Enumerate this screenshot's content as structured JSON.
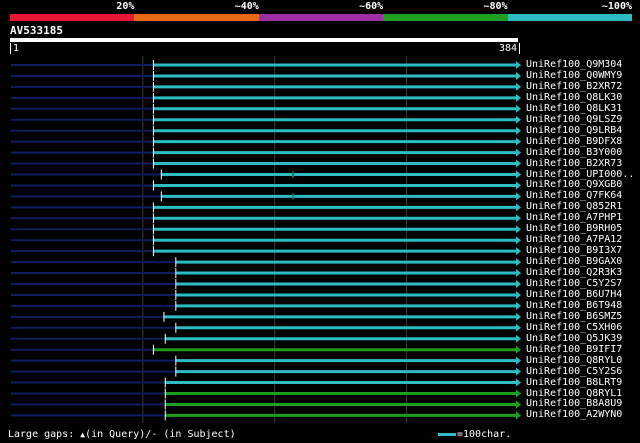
{
  "legend": {
    "segments": [
      {
        "label": "20%",
        "color": "#e8173a"
      },
      {
        "label": "~40%",
        "color": "#e86a17"
      },
      {
        "label": "~60%",
        "color": "#9b2fa3"
      },
      {
        "label": "~80%",
        "color": "#1e9e1e"
      },
      {
        "label": "~100%",
        "color": "#2bbcc6"
      }
    ]
  },
  "query": {
    "id": "AV533185",
    "start": "1",
    "end": "384"
  },
  "colors": {
    "background_line": "#0e1e63",
    "grid": "#3a3a3a",
    "gap_marker": "#1a7a5a"
  },
  "hits": [
    {
      "label": "UniRef100_Q9M304",
      "start": 109,
      "end": 384,
      "color": "#2bbcc6",
      "gap": null
    },
    {
      "label": "UniRef100_Q0WMY9",
      "start": 109,
      "end": 384,
      "color": "#2bbcc6",
      "gap": null
    },
    {
      "label": "UniRef100_B2XR72",
      "start": 109,
      "end": 384,
      "color": "#2bbcc6",
      "gap": null
    },
    {
      "label": "UniRef100_Q8LK30",
      "start": 109,
      "end": 384,
      "color": "#2bbcc6",
      "gap": null
    },
    {
      "label": "UniRef100_Q8LK31",
      "start": 109,
      "end": 384,
      "color": "#2bbcc6",
      "gap": null
    },
    {
      "label": "UniRef100_Q9LSZ9",
      "start": 109,
      "end": 384,
      "color": "#2bbcc6",
      "gap": null
    },
    {
      "label": "UniRef100_Q9LRB4",
      "start": 109,
      "end": 384,
      "color": "#2bbcc6",
      "gap": null
    },
    {
      "label": "UniRef100_B9DFX8",
      "start": 109,
      "end": 384,
      "color": "#2bbcc6",
      "gap": null
    },
    {
      "label": "UniRef100_B3Y000",
      "start": 109,
      "end": 384,
      "color": "#2bbcc6",
      "gap": null
    },
    {
      "label": "UniRef100_B2XR73",
      "start": 109,
      "end": 384,
      "color": "#2bbcc6",
      "gap": null
    },
    {
      "label": "UniRef100_UPI000..",
      "start": 115,
      "end": 384,
      "color": "#2bbcc6",
      "gap": 215
    },
    {
      "label": "UniRef100_Q9XGB0",
      "start": 109,
      "end": 384,
      "color": "#2bbcc6",
      "gap": null
    },
    {
      "label": "UniRef100_Q7FK64",
      "start": 115,
      "end": 384,
      "color": "#2bbcc6",
      "gap": 215
    },
    {
      "label": "UniRef100_Q852R1",
      "start": 109,
      "end": 384,
      "color": "#2bbcc6",
      "gap": null
    },
    {
      "label": "UniRef100_A7PHP1",
      "start": 109,
      "end": 384,
      "color": "#2bbcc6",
      "gap": null
    },
    {
      "label": "UniRef100_B9RH05",
      "start": 109,
      "end": 384,
      "color": "#2bbcc6",
      "gap": null
    },
    {
      "label": "UniRef100_A7PA12",
      "start": 109,
      "end": 384,
      "color": "#2bbcc6",
      "gap": null
    },
    {
      "label": "UniRef100_B9I3X7",
      "start": 109,
      "end": 384,
      "color": "#2bbcc6",
      "gap": null
    },
    {
      "label": "UniRef100_B9GAX0",
      "start": 126,
      "end": 384,
      "color": "#2bbcc6",
      "gap": null
    },
    {
      "label": "UniRef100_Q2R3K3",
      "start": 126,
      "end": 384,
      "color": "#2bbcc6",
      "gap": null
    },
    {
      "label": "UniRef100_C5Y2S7",
      "start": 126,
      "end": 384,
      "color": "#2bbcc6",
      "gap": null
    },
    {
      "label": "UniRef100_B6U7H4",
      "start": 126,
      "end": 384,
      "color": "#2bbcc6",
      "gap": null
    },
    {
      "label": "UniRef100_B6T948",
      "start": 126,
      "end": 384,
      "color": "#2bbcc6",
      "gap": null
    },
    {
      "label": "UniRef100_B6SMZ5",
      "start": 117,
      "end": 384,
      "color": "#2bbcc6",
      "gap": null
    },
    {
      "label": "UniRef100_C5XH06",
      "start": 126,
      "end": 384,
      "color": "#2bbcc6",
      "gap": null
    },
    {
      "label": "UniRef100_Q5JK39",
      "start": 118,
      "end": 384,
      "color": "#2bbcc6",
      "gap": null
    },
    {
      "label": "UniRef100_B9IFI7",
      "start": 109,
      "end": 384,
      "color": "#1e9e1e",
      "gap": null
    },
    {
      "label": "UniRef100_Q8RYL0",
      "start": 126,
      "end": 384,
      "color": "#2bbcc6",
      "gap": null
    },
    {
      "label": "UniRef100_C5Y2S6",
      "start": 126,
      "end": 384,
      "color": "#2bbcc6",
      "gap": null
    },
    {
      "label": "UniRef100_B8LRT9",
      "start": 118,
      "end": 384,
      "color": "#2bbcc6",
      "gap": null
    },
    {
      "label": "UniRef100_Q8RYL1",
      "start": 118,
      "end": 384,
      "color": "#1e9e1e",
      "gap": null
    },
    {
      "label": "UniRef100_B8A8U9",
      "start": 118,
      "end": 384,
      "color": "#1e9e1e",
      "gap": null
    },
    {
      "label": "UniRef100_A2WYN0",
      "start": 118,
      "end": 384,
      "color": "#1e9e1e",
      "gap": null
    }
  ],
  "footer": {
    "gaps_text_1": "Large gaps: ",
    "gaps_query_symbol": "▲",
    "gaps_text_2": "(in Query)/",
    "gaps_subject_symbol": "-",
    "gaps_text_3": " (in Subject)",
    "scale_text": "=100char."
  }
}
